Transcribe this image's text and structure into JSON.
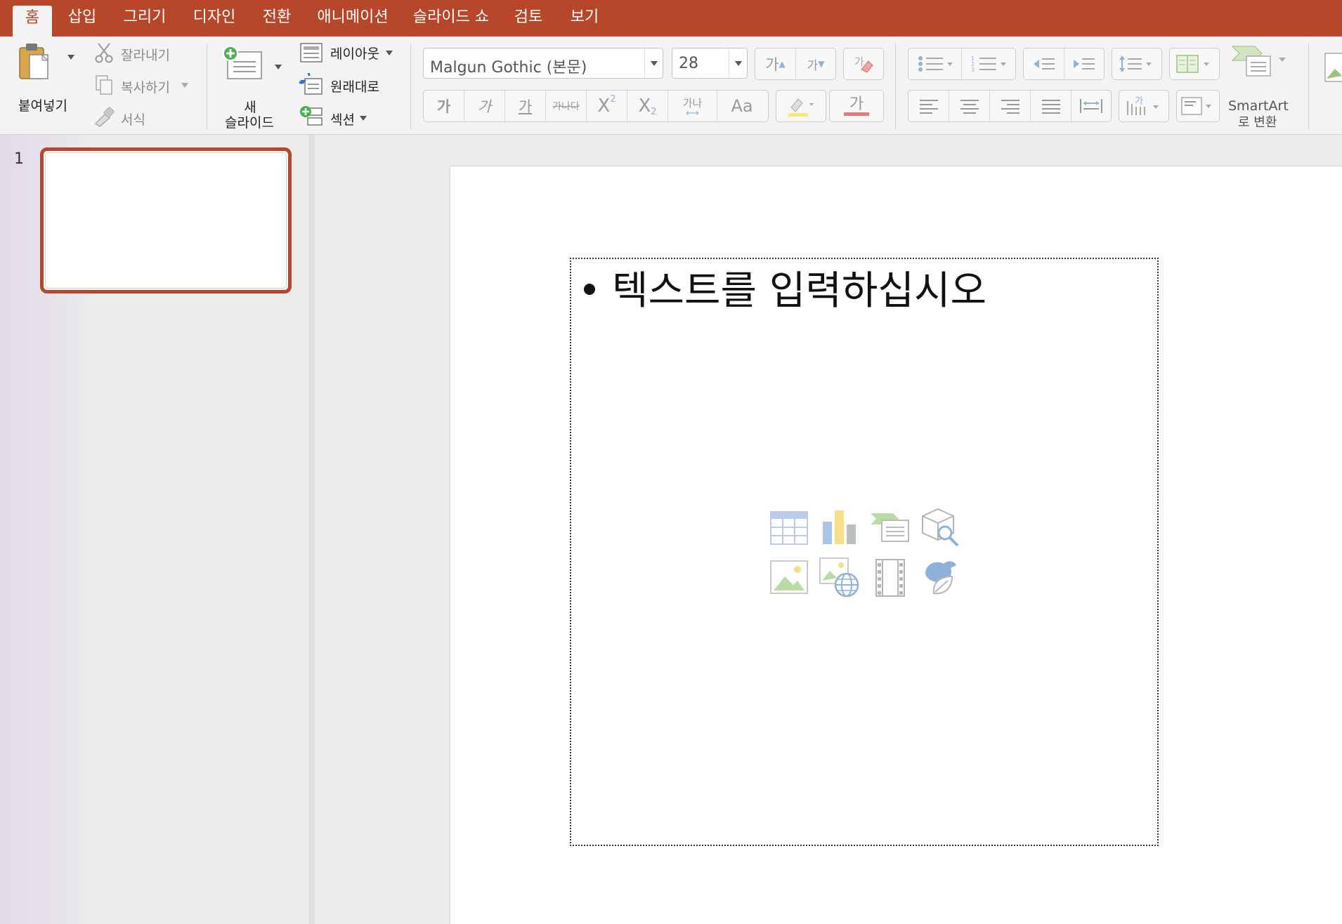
{
  "tabs": [
    {
      "label": "홈",
      "active": true
    },
    {
      "label": "삽입"
    },
    {
      "label": "그리기"
    },
    {
      "label": "디자인"
    },
    {
      "label": "전환"
    },
    {
      "label": "애니메이션"
    },
    {
      "label": "슬라이드 쇼"
    },
    {
      "label": "검토"
    },
    {
      "label": "보기"
    }
  ],
  "clipboard": {
    "paste": "붙여넣기",
    "cut": "잘라내기",
    "copy": "복사하기",
    "format": "서식"
  },
  "slides_group": {
    "new_slide_line1": "새",
    "new_slide_line2": "슬라이드",
    "layout": "레이아웃",
    "reset": "원래대로",
    "section": "섹션"
  },
  "font": {
    "name": "Malgun Gothic (본문)",
    "size": "28",
    "grow_label": "가",
    "shrink_label": "가",
    "bold": "가",
    "italic": "가",
    "underline": "가",
    "strike": "가나다",
    "superscript": "X",
    "subscript": "X",
    "spacing": "가나",
    "case": "Aa",
    "font_color_label": "가"
  },
  "smartart": {
    "line1": "SmartArt",
    "line2": "로 변환"
  },
  "slide_panel": {
    "number": "1"
  },
  "slide": {
    "body_text": "텍스트를 입력하십시오"
  },
  "colors": {
    "accent": "#b7472a"
  }
}
